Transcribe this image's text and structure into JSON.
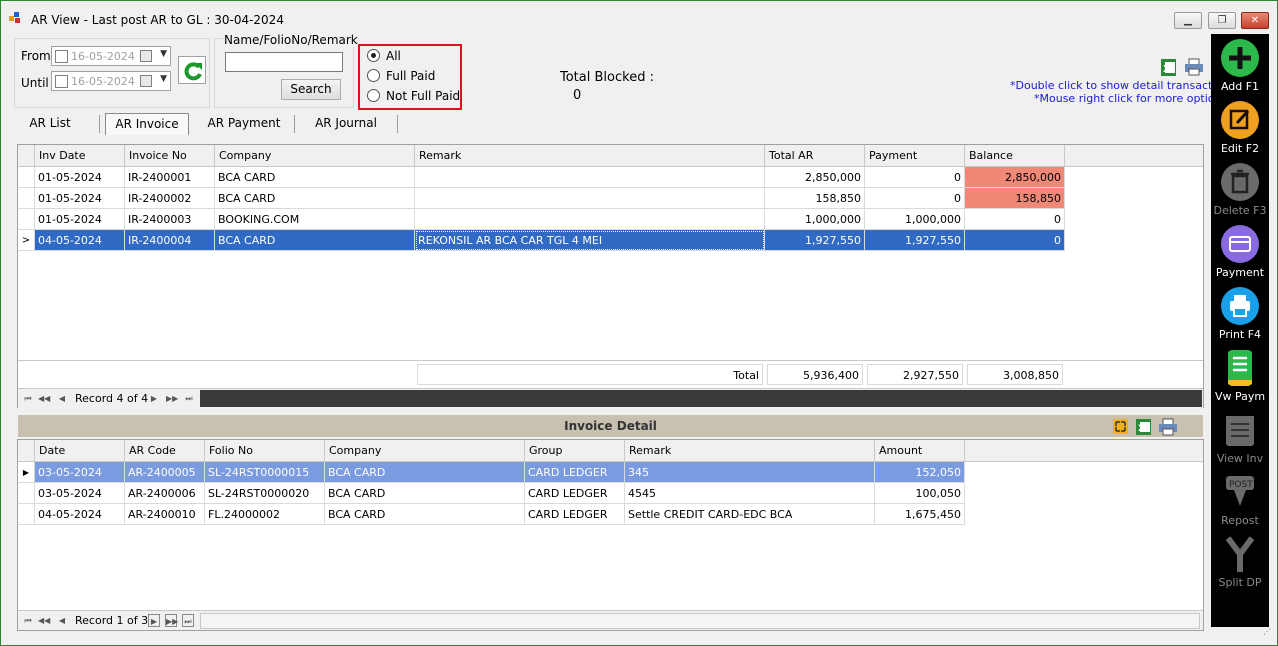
{
  "window": {
    "title": "AR View - Last post AR to GL : 30-04-2024",
    "min_label": "▭",
    "max_label": "▫",
    "close_label": "✕"
  },
  "filter": {
    "from_label": "From",
    "until_label": "Until",
    "from_value": "16-05-2024",
    "until_value": "16-05-2024",
    "search_label": "Name/FolioNo/Remark",
    "search_value": "",
    "search_button": "Search"
  },
  "radio": {
    "options": [
      "All",
      "Full Paid",
      "Not Full Paid"
    ],
    "selected": "All"
  },
  "total_blocked": {
    "label": "Total Blocked :",
    "value": "0"
  },
  "hints": [
    "*Double click to show detail transaction",
    "*Mouse right click for more options"
  ],
  "tabs": [
    "AR List",
    "AR Invoice",
    "AR Payment",
    "AR Journal"
  ],
  "active_tab": "AR Invoice",
  "invoice_grid": {
    "columns": [
      "Inv Date",
      "Invoice No",
      "Company",
      "Remark",
      "Total AR",
      "Payment",
      "Balance"
    ],
    "rows": [
      {
        "inv_date": "01-05-2024",
        "invoice_no": "IR-2400001",
        "company": "BCA CARD",
        "remark": "",
        "total_ar": "2,850,000",
        "payment": "0",
        "balance": "2,850,000"
      },
      {
        "inv_date": "01-05-2024",
        "invoice_no": "IR-2400002",
        "company": "BCA CARD",
        "remark": "",
        "total_ar": "158,850",
        "payment": "0",
        "balance": "158,850"
      },
      {
        "inv_date": "01-05-2024",
        "invoice_no": "IR-2400003",
        "company": "BOOKING.COM",
        "remark": "",
        "total_ar": "1,000,000",
        "payment": "1,000,000",
        "balance": "0"
      },
      {
        "inv_date": "04-05-2024",
        "invoice_no": "IR-2400004",
        "company": "BCA CARD",
        "remark": "REKONSIL AR BCA CAR TGL 4 MEI",
        "total_ar": "1,927,550",
        "payment": "1,927,550",
        "balance": "0"
      }
    ],
    "total_label": "Total",
    "total_ar": "5,936,400",
    "total_payment": "2,927,550",
    "total_balance": "3,008,850",
    "record_text": "Record 4 of 4"
  },
  "detail_title": "Invoice Detail",
  "detail_grid": {
    "columns": [
      "Date",
      "AR Code",
      "Folio No",
      "Company",
      "Group",
      "Remark",
      "Amount"
    ],
    "rows": [
      {
        "date": "03-05-2024",
        "ar_code": "AR-2400005",
        "folio_no": "SL-24RST0000015",
        "company": "BCA CARD",
        "group": "CARD LEDGER",
        "remark": "345",
        "amount": "152,050"
      },
      {
        "date": "03-05-2024",
        "ar_code": "AR-2400006",
        "folio_no": "SL-24RST0000020",
        "company": "BCA CARD",
        "group": "CARD LEDGER",
        "remark": "4545",
        "amount": "100,050"
      },
      {
        "date": "04-05-2024",
        "ar_code": "AR-2400010",
        "folio_no": "FL.24000002",
        "company": "BCA CARD",
        "group": "CARD LEDGER",
        "remark": "Settle CREDIT CARD-EDC BCA",
        "amount": "1,675,450"
      }
    ],
    "record_text": "Record 1 of 3"
  },
  "sidebar": [
    {
      "label": "Add F1",
      "icon": "plus-icon",
      "color": "#2db84a",
      "enabled": true
    },
    {
      "label": "Edit F2",
      "icon": "edit-icon",
      "color": "#f0a020",
      "enabled": true
    },
    {
      "label": "Delete F3",
      "icon": "trash-icon",
      "color": "#6a6a6a",
      "enabled": false
    },
    {
      "label": "Payment",
      "icon": "payment-icon",
      "color": "#8a6ae0",
      "enabled": true
    },
    {
      "label": "Print F4",
      "icon": "printer-icon",
      "color": "#1aa0e8",
      "enabled": true
    },
    {
      "label": "Vw Paym",
      "icon": "receipt-icon",
      "color": "#2db84a",
      "enabled": true
    },
    {
      "label": "View Inv",
      "icon": "invoice-icon",
      "color": "#6a6a6a",
      "enabled": false
    },
    {
      "label": "Repost",
      "icon": "post-icon",
      "color": "#6a6a6a",
      "enabled": false
    },
    {
      "label": "Split DP",
      "icon": "split-icon",
      "color": "#6a6a6a",
      "enabled": false
    }
  ]
}
